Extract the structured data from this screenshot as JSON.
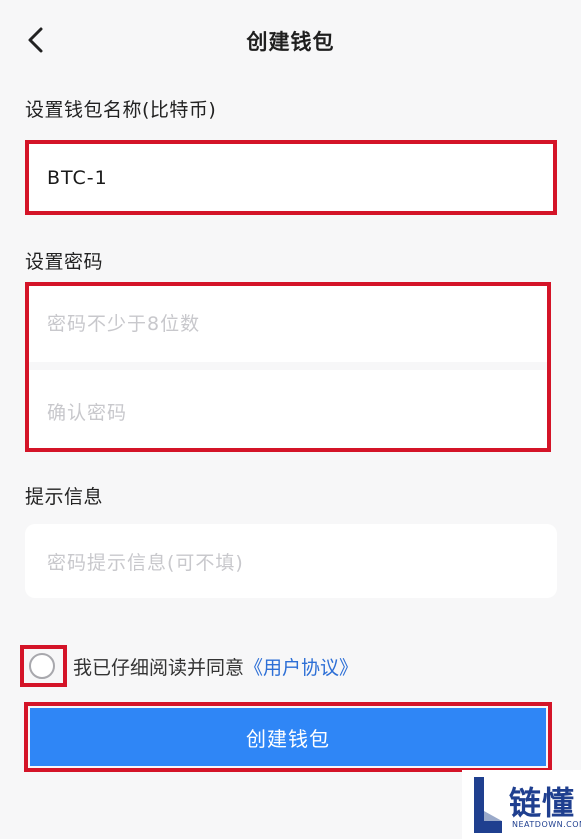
{
  "header": {
    "back_icon": "chevron-left-icon",
    "title": "创建钱包"
  },
  "wallet_name": {
    "label": "设置钱包名称(比特币)",
    "value": "BTC-1"
  },
  "password": {
    "label": "设置密码",
    "placeholder": "密码不少于8位数",
    "confirm_placeholder": "确认密码"
  },
  "hint": {
    "label": "提示信息",
    "placeholder": "密码提示信息(可不填)"
  },
  "agreement": {
    "text": "我已仔细阅读并同意",
    "link": "《用户协议》",
    "checked": false
  },
  "submit": {
    "label": "创建钱包",
    "color": "#2f86f6"
  },
  "highlight_color": "#d41428",
  "watermark": {
    "cn": "链懂",
    "en": "NEATDOWN.COM"
  }
}
